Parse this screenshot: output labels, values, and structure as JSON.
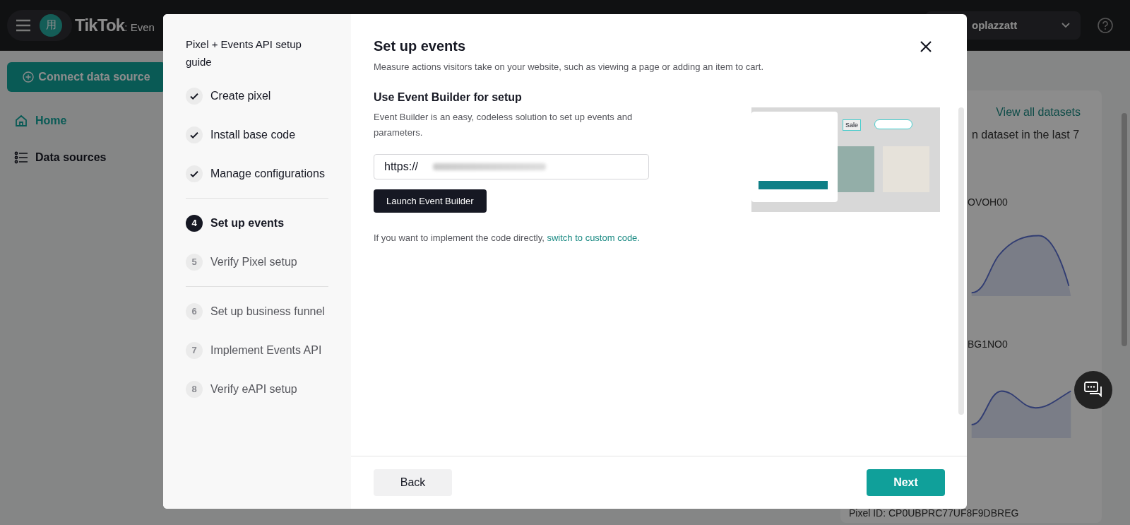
{
  "top_bar": {
    "avatar": "用",
    "logo": "TikTok",
    "logo_suffix": ": Even",
    "account": "oplazzatt"
  },
  "sidebar": {
    "connect_button": "Connect data source",
    "items": [
      {
        "label": "Home",
        "selected": true
      },
      {
        "label": "Data sources",
        "selected": false
      }
    ]
  },
  "dataset_card": {
    "link": "View all datasets",
    "subtitle": "n dataset in the last 7",
    "datasets": [
      {
        "id": "OVOH00"
      },
      {
        "id": "BG1NO0"
      }
    ],
    "pixel_id": "Pixel ID: CP0UBPRC77UF8F9DBREG"
  },
  "guide": {
    "title": "Pixel + Events API setup guide",
    "groups": [
      {
        "steps": [
          {
            "label": "Create pixel",
            "done": true,
            "selected": false
          },
          {
            "label": "Install base code",
            "done": true,
            "selected": false
          },
          {
            "label": "Manage configurations",
            "done": true,
            "selected": false
          }
        ]
      },
      {
        "steps": [
          {
            "number": "4",
            "label": "Set up events",
            "done": false,
            "selected": true
          },
          {
            "number": "5",
            "label": "Verify Pixel setup",
            "done": false,
            "selected": false
          }
        ]
      },
      {
        "steps": [
          {
            "number": "6",
            "label": "Set up business funnel",
            "done": false,
            "selected": false
          },
          {
            "number": "7",
            "label": "Implement Events API",
            "done": false,
            "selected": false
          },
          {
            "number": "8",
            "label": "Verify eAPI setup",
            "done": false,
            "selected": false
          }
        ]
      }
    ]
  },
  "panel": {
    "title": "Set up events",
    "description": "Measure actions visitors take on your website, such as viewing a page or adding an item to cart.",
    "section_title": "Use Event Builder for setup",
    "section_text": "Event Builder is an easy, codeless solution to set up events and parameters.",
    "url_value": "https://",
    "launch_button": "Launch Event Builder",
    "hint": "If you want to implement the code directly,",
    "hint_link": "switch to custom code.",
    "illustration": {
      "sale_label": "Sale"
    }
  },
  "footer": {
    "back": "Back",
    "next": "Next"
  }
}
